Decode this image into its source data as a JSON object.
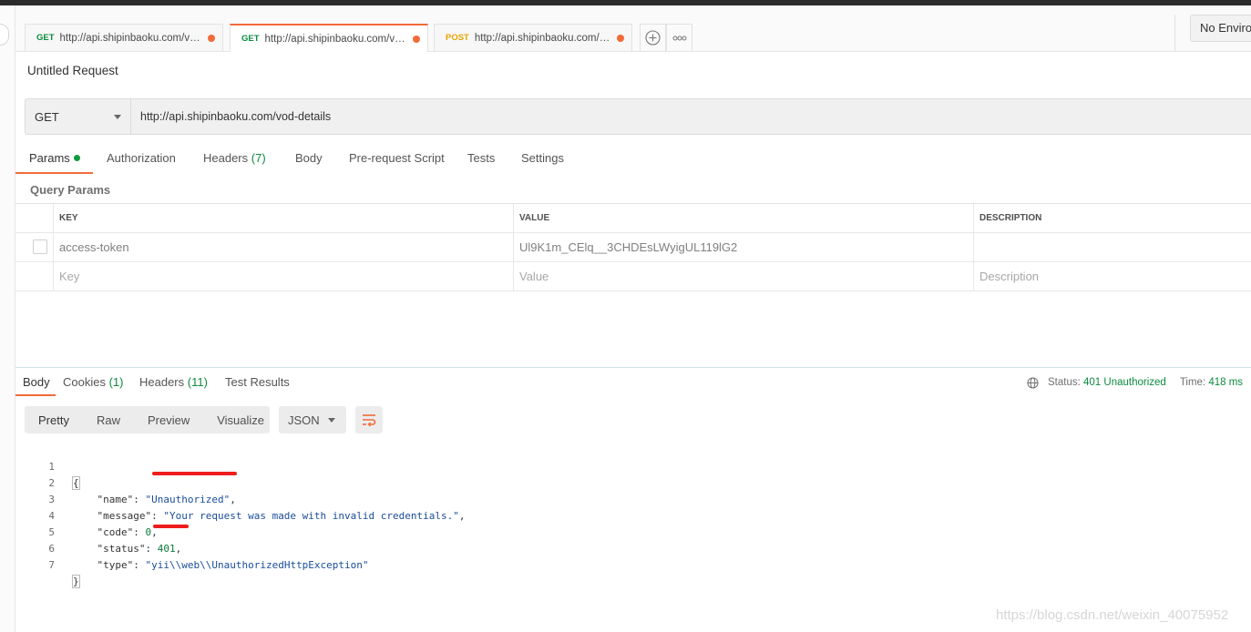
{
  "tabs": [
    {
      "method": "GET",
      "url": "http://api.shipinbaoku.com/vod..."
    },
    {
      "method": "GET",
      "url": "http://api.shipinbaoku.com/vod..."
    },
    {
      "method": "POST",
      "url": "http://api.shipinbaoku.com/us..."
    }
  ],
  "tab_actions": {
    "new_tab_icon": "plus-circle-icon",
    "more_icon": "ellipsis-icon"
  },
  "environment": {
    "selected": "No Environment"
  },
  "request": {
    "title": "Untitled Request",
    "method": "GET",
    "url": "http://api.shipinbaoku.com/vod-details"
  },
  "request_tabs": [
    {
      "label": "Params",
      "has_dot": true
    },
    {
      "label": "Authorization"
    },
    {
      "label": "Headers",
      "count": "(7)"
    },
    {
      "label": "Body"
    },
    {
      "label": "Pre-request Script"
    },
    {
      "label": "Tests"
    },
    {
      "label": "Settings"
    }
  ],
  "query_params": {
    "title": "Query Params",
    "headers": [
      "KEY",
      "VALUE",
      "DESCRIPTION"
    ],
    "rows": [
      {
        "key": "access-token",
        "value": "Ul9K1m_CElq__3CHDEsLWyigUL119lG2",
        "description": ""
      }
    ],
    "placeholders": {
      "key": "Key",
      "value": "Value",
      "description": "Description"
    }
  },
  "response_tabs": [
    {
      "label": "Body"
    },
    {
      "label": "Cookies",
      "count": "(1)"
    },
    {
      "label": "Headers",
      "count": "(11)"
    },
    {
      "label": "Test Results"
    }
  ],
  "response_status": {
    "status_label": "Status:",
    "status_value": "401 Unauthorized",
    "time_label": "Time:",
    "time_value": "418 ms"
  },
  "view_modes": [
    "Pretty",
    "Raw",
    "Preview",
    "Visualize"
  ],
  "format": "JSON",
  "code_lines": [
    "1",
    "2",
    "3",
    "4",
    "5",
    "6",
    "7"
  ],
  "response_json": {
    "name_key": "\"name\"",
    "name_val": "\"Unauthorized\"",
    "message_key": "\"message\"",
    "message_val": "\"Your request was made with invalid credentials.\"",
    "code_key": "\"code\"",
    "code_val": "0",
    "status_key": "\"status\"",
    "status_val": "401",
    "type_key": "\"type\"",
    "type_val": "\"yii\\\\web\\\\UnauthorizedHttpException\""
  },
  "colors": {
    "accent": "#f26b3a",
    "success": "#0c8b3e",
    "annotation": "#ee1c1c"
  },
  "watermark": "https://blog.csdn.net/weixin_40075952"
}
